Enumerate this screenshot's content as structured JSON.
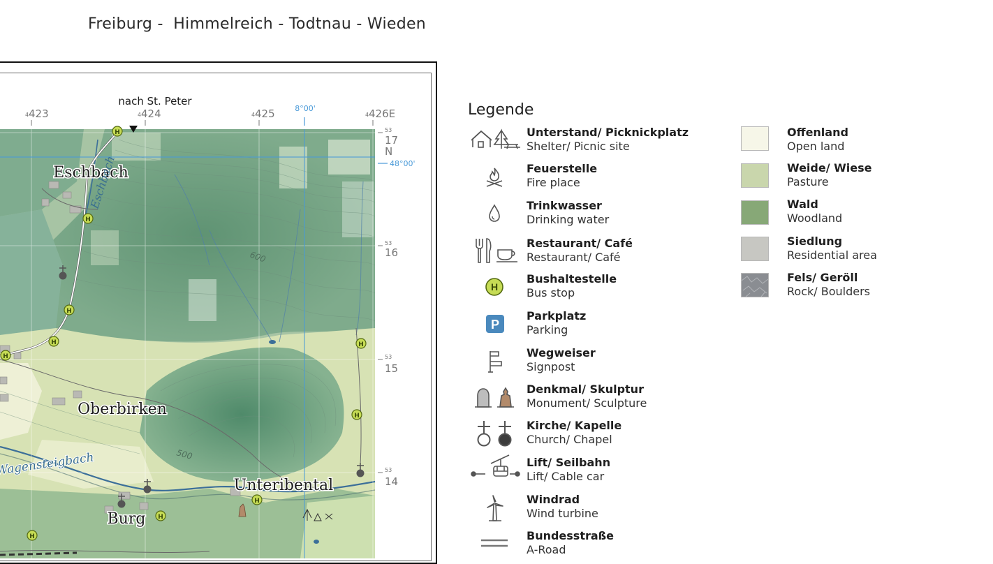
{
  "header": {
    "title": "Freiburg -  Himmelreich - Todtnau - Wieden"
  },
  "map": {
    "top_label": "nach St. Peter",
    "grid_top": [
      "423",
      "424",
      "425",
      "426E"
    ],
    "grid_top_sup": "4",
    "lon_label": "8°00'",
    "grid_right": [
      "17",
      "16",
      "15",
      "14"
    ],
    "grid_right_sup": "53",
    "north_label": "N",
    "lat_label": "48°00'",
    "places": [
      "Eschbach",
      "Oberbirken",
      "Unteribental",
      "Burg"
    ],
    "rivers": [
      "Eschbach",
      "Wagensteigbach"
    ],
    "contours": [
      "600",
      "500"
    ],
    "bus_stop_symbol": "H"
  },
  "legend": {
    "title": "Legende",
    "symbols": [
      {
        "de": "Unterstand/ Picknickplatz",
        "en": "Shelter/ Picnic site",
        "icon": "shelter-picnic-icon"
      },
      {
        "de": "Feuerstelle",
        "en": "Fire place",
        "icon": "campfire-icon"
      },
      {
        "de": "Trinkwasser",
        "en": "Drinking water",
        "icon": "water-drop-icon"
      },
      {
        "de": "Restaurant/ Café",
        "en": "Restaurant/ Café",
        "icon": "restaurant-cafe-icon"
      },
      {
        "de": "Bushaltestelle",
        "en": "Bus stop",
        "icon": "bus-stop-icon"
      },
      {
        "de": "Parkplatz",
        "en": "Parking",
        "icon": "parking-icon"
      },
      {
        "de": "Wegweiser",
        "en": "Signpost",
        "icon": "signpost-icon"
      },
      {
        "de": "Denkmal/ Skulptur",
        "en": "Monument/ Sculpture",
        "icon": "monument-sculpture-icon"
      },
      {
        "de": "Kirche/ Kapelle",
        "en": "Church/ Chapel",
        "icon": "church-chapel-icon"
      },
      {
        "de": "Lift/ Seilbahn",
        "en": "Lift/ Cable car",
        "icon": "cable-car-icon"
      },
      {
        "de": "Windrad",
        "en": "Wind turbine",
        "icon": "wind-turbine-icon"
      },
      {
        "de": "Bundesstraße",
        "en": "A-Road",
        "icon": "a-road-icon"
      }
    ],
    "areas": [
      {
        "de": "Offenland",
        "en": "Open land",
        "color": "#f6f6e8"
      },
      {
        "de": "Weide/ Wiese",
        "en": "Pasture",
        "color": "#c9d6ac"
      },
      {
        "de": "Wald",
        "en": "Woodland",
        "color": "#87a877"
      },
      {
        "de": "Siedlung",
        "en": "Residential area",
        "color": "#c7c7c2"
      },
      {
        "de": "Fels/ Geröll",
        "en": "Rock/ Boulders",
        "color": "#8a8d92"
      }
    ],
    "parking_letter": "P",
    "bus_letter": "H"
  }
}
